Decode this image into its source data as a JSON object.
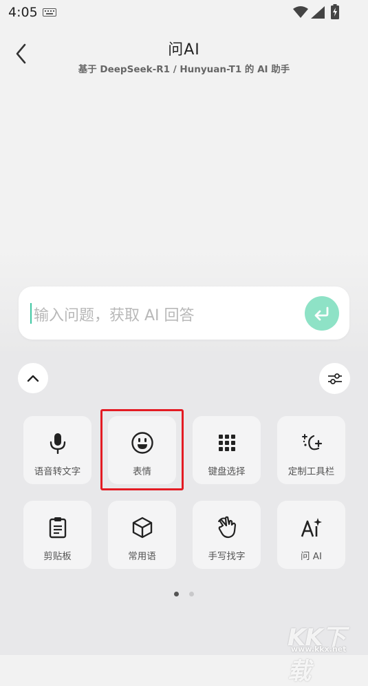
{
  "status_bar": {
    "time": "4:05"
  },
  "header": {
    "title": "问AI",
    "subtitle": "基于 DeepSeek-R1 / Hunyuan-T1 的 AI 助手"
  },
  "input": {
    "placeholder": "输入问题，获取 AI 回答"
  },
  "toolbar": {
    "tiles": [
      {
        "label": "语音转文字",
        "icon": "microphone-icon"
      },
      {
        "label": "表情",
        "icon": "emoji-icon"
      },
      {
        "label": "键盘选择",
        "icon": "keyboard-grid-icon"
      },
      {
        "label": "定制工具栏",
        "icon": "magic-sparkle-icon"
      },
      {
        "label": "剪贴板",
        "icon": "clipboard-icon"
      },
      {
        "label": "常用语",
        "icon": "cube-icon"
      },
      {
        "label": "手写找字",
        "icon": "handwriting-icon"
      },
      {
        "label": "问 AI",
        "icon": "ai-sparkle-icon"
      }
    ]
  },
  "pagination": {
    "current": 1,
    "total": 2
  },
  "watermark": {
    "text": "KK下载",
    "url": "www.kkx.net"
  },
  "colors": {
    "accent": "#8ee2c6",
    "highlight": "#e31b23"
  }
}
